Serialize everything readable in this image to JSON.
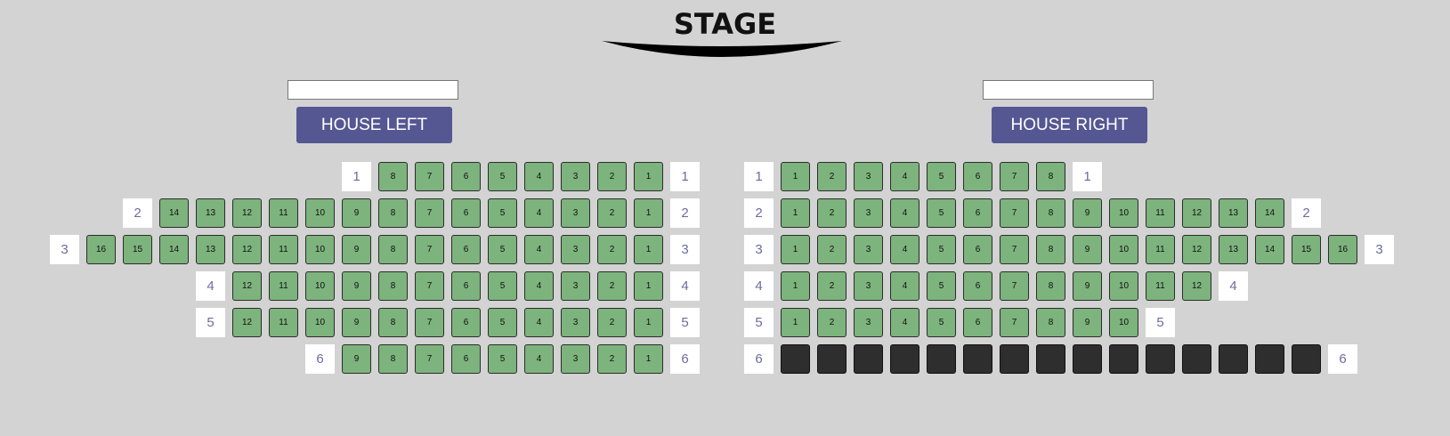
{
  "stage": {
    "title": "STAGE"
  },
  "house_left": {
    "input_value": "",
    "button_label": "HOUSE LEFT"
  },
  "house_right": {
    "input_value": "",
    "button_label": "HOUSE RIGHT"
  },
  "colors": {
    "available": "#7db37d",
    "unavailable": "#2e2e2e",
    "button": "#555793",
    "row_label_text": "#6b6d9e"
  },
  "left_rows": [
    {
      "row": "1",
      "seats": [
        "8",
        "7",
        "6",
        "5",
        "4",
        "3",
        "2",
        "1"
      ]
    },
    {
      "row": "2",
      "seats": [
        "14",
        "13",
        "12",
        "11",
        "10",
        "9",
        "8",
        "7",
        "6",
        "5",
        "4",
        "3",
        "2",
        "1"
      ]
    },
    {
      "row": "3",
      "seats": [
        "16",
        "15",
        "14",
        "13",
        "12",
        "11",
        "10",
        "9",
        "8",
        "7",
        "6",
        "5",
        "4",
        "3",
        "2",
        "1"
      ]
    },
    {
      "row": "4",
      "seats": [
        "12",
        "11",
        "10",
        "9",
        "8",
        "7",
        "6",
        "5",
        "4",
        "3",
        "2",
        "1"
      ]
    },
    {
      "row": "5",
      "seats": [
        "12",
        "11",
        "10",
        "9",
        "8",
        "7",
        "6",
        "5",
        "4",
        "3",
        "2",
        "1"
      ]
    },
    {
      "row": "6",
      "seats": [
        "9",
        "8",
        "7",
        "6",
        "5",
        "4",
        "3",
        "2",
        "1"
      ]
    }
  ],
  "right_rows": [
    {
      "row": "1",
      "seats": [
        "1",
        "2",
        "3",
        "4",
        "5",
        "6",
        "7",
        "8"
      ],
      "unavailable": false
    },
    {
      "row": "2",
      "seats": [
        "1",
        "2",
        "3",
        "4",
        "5",
        "6",
        "7",
        "8",
        "9",
        "10",
        "11",
        "12",
        "13",
        "14"
      ],
      "unavailable": false
    },
    {
      "row": "3",
      "seats": [
        "1",
        "2",
        "3",
        "4",
        "5",
        "6",
        "7",
        "8",
        "9",
        "10",
        "11",
        "12",
        "13",
        "14",
        "15",
        "16"
      ],
      "unavailable": false
    },
    {
      "row": "4",
      "seats": [
        "1",
        "2",
        "3",
        "4",
        "5",
        "6",
        "7",
        "8",
        "9",
        "10",
        "11",
        "12"
      ],
      "unavailable": false
    },
    {
      "row": "5",
      "seats": [
        "1",
        "2",
        "3",
        "4",
        "5",
        "6",
        "7",
        "8",
        "9",
        "10"
      ],
      "unavailable": false
    },
    {
      "row": "6",
      "seats": [
        "",
        "",
        "",
        "",
        "",
        "",
        "",
        "",
        "",
        "",
        "",
        "",
        "",
        "",
        ""
      ],
      "unavailable": true
    }
  ]
}
